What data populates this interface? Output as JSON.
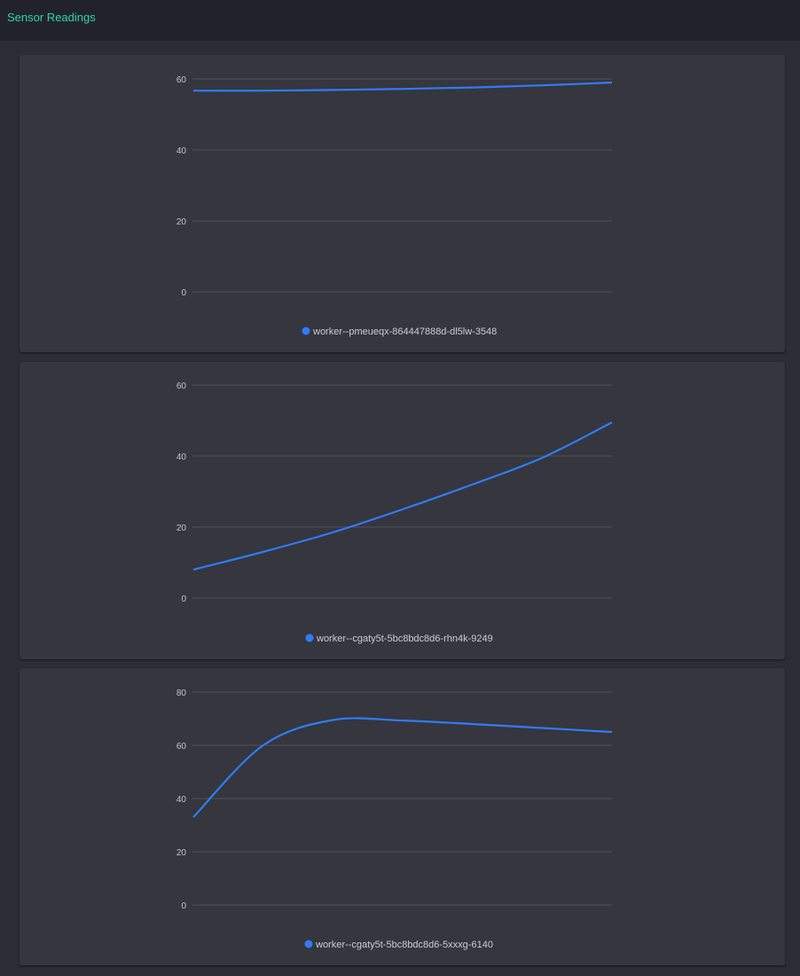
{
  "app": {
    "title": "Sensor Readings"
  },
  "colors": {
    "accent": "#2fd5a8",
    "series": "#2f7cf6",
    "grid": "#4f5058"
  },
  "chart_data": [
    {
      "type": "line",
      "ylim": [
        0,
        60
      ],
      "yticks": [
        "60",
        "40",
        "20",
        "0"
      ],
      "series": [
        {
          "name": "worker--pmeueqx-864447888d-dl5lw-3548",
          "values": [
            56.7,
            56.7,
            56.9,
            57.2,
            57.6,
            58.2,
            59.0
          ]
        }
      ]
    },
    {
      "type": "line",
      "ylim": [
        0,
        60
      ],
      "yticks": [
        "60",
        "40",
        "20",
        "0"
      ],
      "series": [
        {
          "name": "worker--cgaty5t-5bc8bdc8d6-rhn4k-9249",
          "values": [
            8.0,
            13.0,
            18.5,
            25.0,
            32.0,
            39.5,
            49.5
          ]
        }
      ]
    },
    {
      "type": "line",
      "ylim": [
        0,
        80
      ],
      "yticks": [
        "80",
        "60",
        "40",
        "20",
        "0"
      ],
      "series": [
        {
          "name": "worker--cgaty5t-5bc8bdc8d6-5xxxg-6140",
          "values": [
            33.0,
            60.0,
            69.5,
            69.3,
            68.0,
            66.5,
            65.0
          ]
        }
      ]
    }
  ]
}
